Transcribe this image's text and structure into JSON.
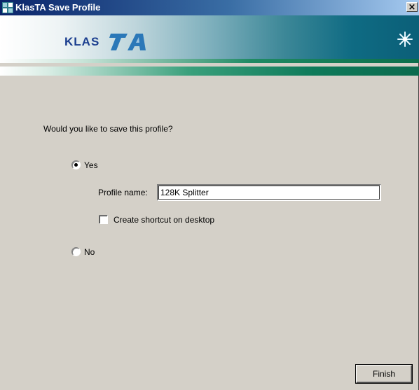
{
  "window": {
    "title": "KlasTA Save Profile",
    "close_label": "×"
  },
  "banner": {
    "logo_text": "KLAS",
    "logo_mark": "TA",
    "icon": "snowflake-icon"
  },
  "form": {
    "question": "Would you like to save this profile?",
    "yes_label": "Yes",
    "yes_checked": true,
    "profile_name_label": "Profile name:",
    "profile_name_value": "128K Splitter",
    "shortcut_label": "Create shortcut on desktop",
    "shortcut_checked": false,
    "no_label": "No",
    "no_checked": false
  },
  "buttons": {
    "finish_label": "Finish"
  },
  "colors": {
    "titlebar": "#0a246a",
    "dialog_bg": "#d4d0c8",
    "logo_blue": "#1b3e8f",
    "stripe_green": "#0c6e4b"
  }
}
